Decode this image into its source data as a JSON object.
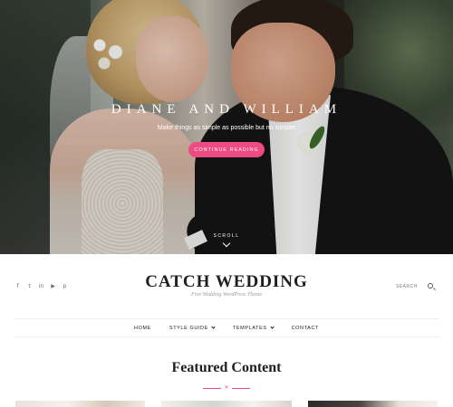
{
  "hero": {
    "title": "Diane and William",
    "subtitle": "Make things as simple as possible but no simpler",
    "button_label": "Continue Reading",
    "scroll_label": "Scroll",
    "accent_color": "#ee4b82"
  },
  "header": {
    "site_title": "CATCH WEDDING",
    "tagline": "Free Wedding WordPress Theme",
    "search_label": "SEARCH",
    "social_icons": [
      "facebook-icon",
      "twitter-icon",
      "linkedin-icon",
      "youtube-icon",
      "pinterest-icon"
    ]
  },
  "nav": {
    "items": [
      {
        "label": "Home"
      },
      {
        "label": "Style Guide"
      },
      {
        "label": "Templates"
      },
      {
        "label": "Contact"
      }
    ]
  },
  "featured": {
    "title": "Featured Content"
  }
}
